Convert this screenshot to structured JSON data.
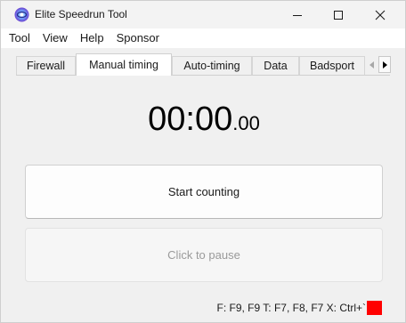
{
  "window": {
    "title": "Elite Speedrun Tool",
    "buttons": [
      "minimize",
      "maximize",
      "close"
    ]
  },
  "menu": {
    "items": [
      "Tool",
      "View",
      "Help",
      "Sponsor"
    ]
  },
  "tabs": {
    "items": [
      "Firewall",
      "Manual timing",
      "Auto-timing",
      "Data",
      "Badsport"
    ],
    "active": "Manual timing",
    "scroll_left_icon": "triangle-left-icon",
    "scroll_right_icon": "triangle-right-icon"
  },
  "timer": {
    "main": "00:00",
    "ms": ".00"
  },
  "buttons": {
    "start_label": "Start counting",
    "pause_label": "Click to pause",
    "pause_enabled": false
  },
  "status": {
    "hotkeys": "F: F9, F9   T: F7, F8, F7   X: Ctrl+`",
    "indicator_color": "#ff0000"
  }
}
